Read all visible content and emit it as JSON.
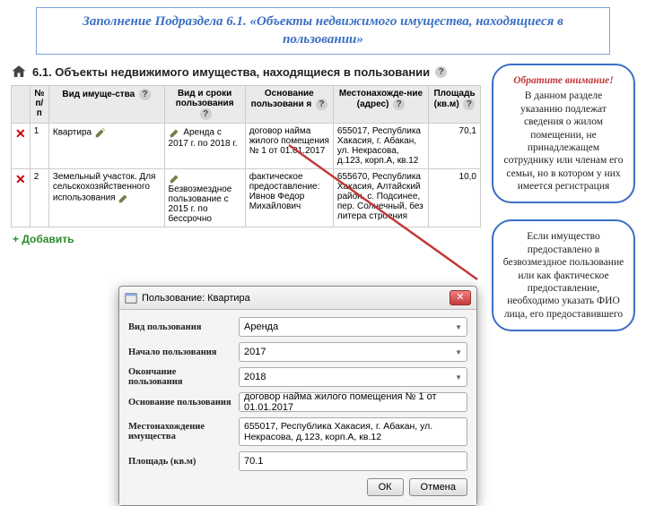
{
  "title": "Заполнение Подраздела 6.1. «Объекты  недвижимого имущества, находящиеся в пользовании»",
  "section": {
    "heading": "6.1. Объекты недвижимого имущества, находящиеся в пользовании"
  },
  "table": {
    "headers": {
      "num": "№ п/п",
      "type": "Вид имуще-ства",
      "term": "Вид и сроки пользования",
      "basis": "Основание пользовани я",
      "location": "Местонахожде-ние (адрес)",
      "area": "Площадь (кв.м)"
    },
    "rows": [
      {
        "num": "1",
        "type": "Квартира",
        "term": "Аренда с 2017 г. по 2018 г.",
        "basis": "договор найма жилого помещения № 1 от 01.01.2017",
        "location": "655017, Республика Хакасия, г. Абакан, ул. Некрасова, д.123, корп.А, кв.12",
        "area": "70,1"
      },
      {
        "num": "2",
        "type": "Земельный участок. Для сельскохозяйственного использования",
        "term": "Безвозмездное пользование с 2015 г. по бессрочно",
        "basis": "фактическое предоставление: Ивнов Федор Михайлович",
        "location": "655670, Республика Хакасия, Алтайский район, с. Подсинее, пер. Солнечный, без литера строения",
        "area": "10,0"
      }
    ],
    "add": "Добавить"
  },
  "dialog": {
    "title": "Пользование: Квартира",
    "labels": {
      "kind": "Вид пользования",
      "start": "Начало пользования",
      "end": "Окончание пользования",
      "basis": "Основание пользования",
      "location": "Местонахождение имущества",
      "area": "Площадь (кв.м)"
    },
    "values": {
      "kind": "Аренда",
      "start": "2017",
      "end": "2018",
      "basis": "договор найма жилого помещения № 1 от 01.01.2017",
      "location": "655017, Республика Хакасия, г. Абакан, ул. Некрасова, д.123, корп.А, кв.12",
      "area": "70.1"
    },
    "buttons": {
      "ok": "ОК",
      "cancel": "Отмена"
    }
  },
  "callouts": {
    "a_head": "Обратите внимание!",
    "a_body": "В данном разделе указанию подлежат сведения о жилом помещении, не принадлежащем сотруднику или членам его семьи, но в котором у них имеется регистрация",
    "b_body": "Если имущество предоставлено в безвозмездное пользование или как фактическое предоставление, необходимо указать ФИО лица, его предоставившего"
  }
}
